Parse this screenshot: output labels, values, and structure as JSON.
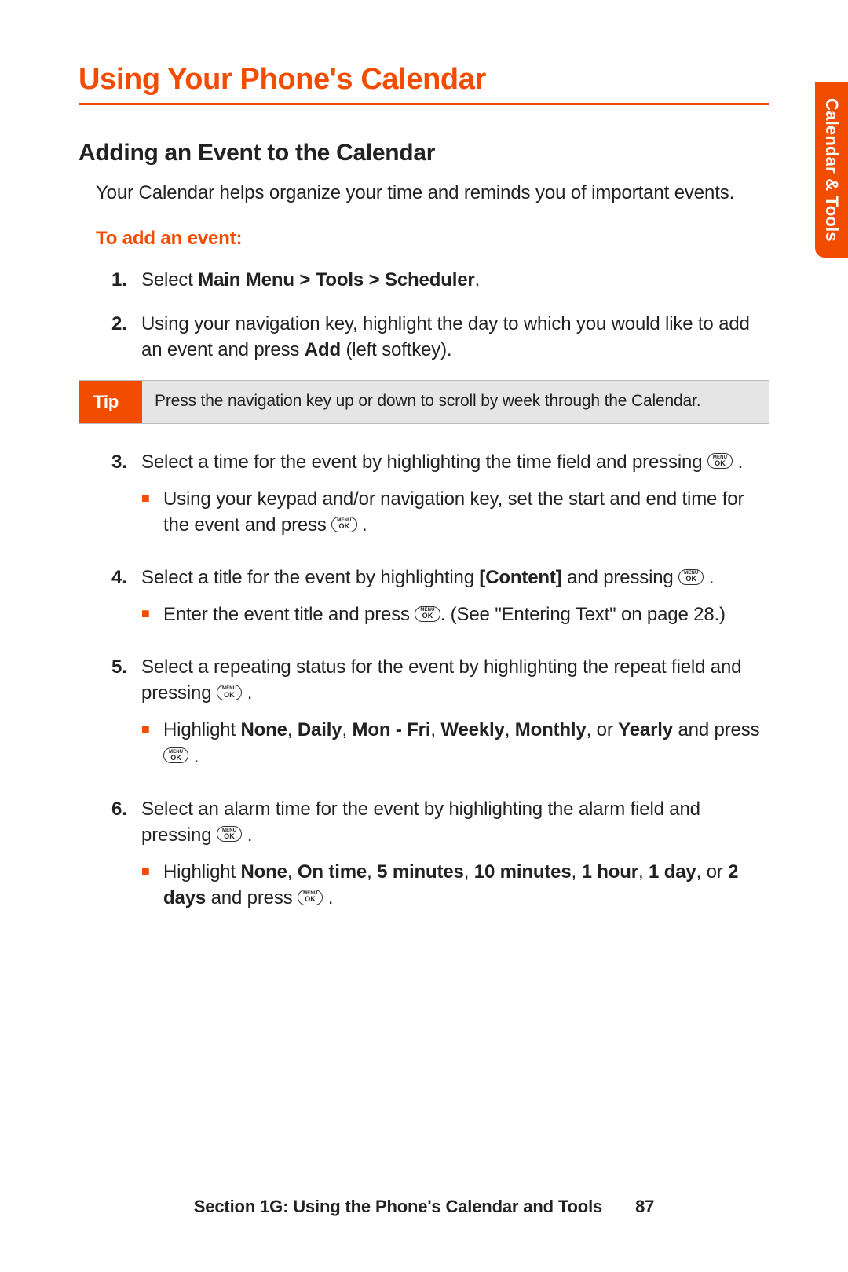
{
  "heading1": "Using Your Phone's Calendar",
  "heading2": "Adding an Event to the Calendar",
  "intro": "Your Calendar helps organize your time and reminds you of important events.",
  "subhead": "To add an event:",
  "sideTab": "Calendar & Tools",
  "tip": {
    "label": "Tip",
    "text": "Press the navigation key up or down to scroll by week through the Calendar."
  },
  "steps": {
    "s1": {
      "num": "1.",
      "a": "Select ",
      "b": "Main Menu > Tools > Scheduler",
      "c": "."
    },
    "s2": {
      "num": "2.",
      "a": "Using your navigation key, highlight the day to which you would like to add an event and press ",
      "b": "Add",
      "c": " (left softkey)."
    },
    "s3": {
      "num": "3.",
      "text": "Select a time for the event by highlighting the time field and pressing ",
      "sub": {
        "a": "Using your keypad and/or navigation key, set the start and end time for the event and press "
      }
    },
    "s4": {
      "num": "4.",
      "a": "Select a title for the event by highlighting ",
      "b": "[Content]",
      "c": " and pressing ",
      "sub": {
        "a": "Enter the event title and press ",
        "b": ". (See \"Entering Text\" on page 28.)"
      }
    },
    "s5": {
      "num": "5.",
      "text": "Select a repeating status for the event by highlighting the repeat field and pressing ",
      "sub": {
        "a": "Highlight ",
        "o1": "None",
        "o2": "Daily",
        "o3": "Mon - Fri",
        "o4": "Weekly",
        "o5": "Monthly",
        "or": ", or ",
        "o6": "Yearly",
        "b": " and press "
      }
    },
    "s6": {
      "num": "6.",
      "text": "Select an alarm time for the event by highlighting the alarm field and pressing ",
      "sub": {
        "a": "Highlight ",
        "o1": "None",
        "o2": "On time",
        "o3": "5 minutes",
        "o4": "10 minutes",
        "o5": "1 hour",
        "o6": "1 day",
        "or": ", or ",
        "o7": "2 days",
        "b": " and press "
      }
    }
  },
  "menuOk": {
    "l1": "MENU",
    "l2": "OK"
  },
  "footer": {
    "section": "Section 1G: Using the Phone's Calendar and Tools",
    "page": "87"
  }
}
